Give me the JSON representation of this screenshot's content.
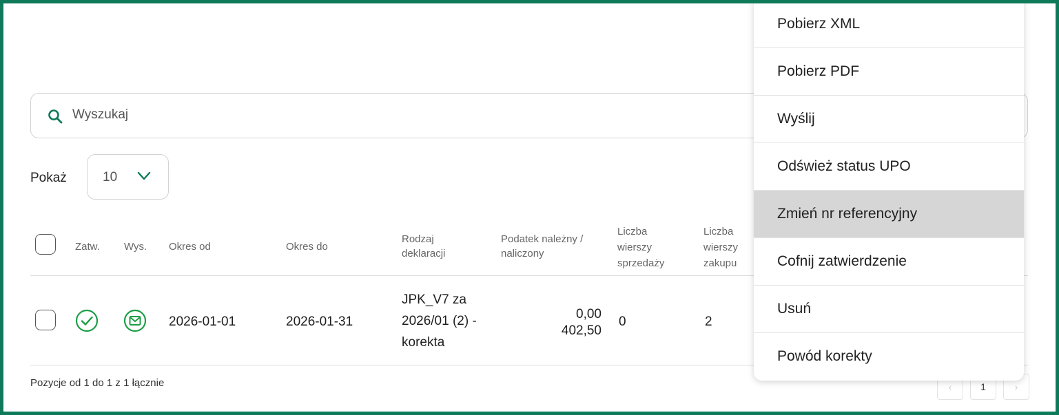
{
  "search": {
    "placeholder": "Wyszukaj"
  },
  "show": {
    "label": "Pokaż",
    "value": "10"
  },
  "table": {
    "headers": {
      "approved": "Zatw.",
      "sent": "Wys.",
      "period_from": "Okres od",
      "period_to": "Okres do",
      "declaration_type": [
        "Rodzaj",
        "deklaracji"
      ],
      "tax": [
        "Podatek należny /",
        "naliczony"
      ],
      "sales_rows": [
        "Liczba",
        "wierszy",
        "sprzedaży"
      ],
      "purchase_rows": [
        "Liczba",
        "wierszy",
        "zakupu"
      ]
    },
    "rows": [
      {
        "period_from": "2026-01-01",
        "period_to": "2026-01-31",
        "declaration_type": [
          "JPK_V7 za",
          "2026/01 (2) -",
          "korekta"
        ],
        "tax_due": "0,00",
        "tax_input": "402,50",
        "sales_rows": "0",
        "purchase_rows": "2"
      }
    ]
  },
  "footer": {
    "summary": "Pozycje od 1 do 1 z 1 łącznie"
  },
  "pagination": {
    "prev": "‹",
    "page": "1",
    "next": "›"
  },
  "menu": {
    "items": [
      {
        "label": "Pobierz XML"
      },
      {
        "label": "Pobierz PDF"
      },
      {
        "label": "Wyślij"
      },
      {
        "label": "Odśwież status UPO"
      },
      {
        "label": "Zmień nr referencyjny"
      },
      {
        "label": "Cofnij zatwierdzenie"
      },
      {
        "label": "Usuń"
      },
      {
        "label": "Powód korekty"
      }
    ],
    "highlighted_index": 4
  },
  "colors": {
    "frame": "#0f7a5a",
    "accent_green": "#1e9e46",
    "highlight": "#d6d6d6"
  }
}
